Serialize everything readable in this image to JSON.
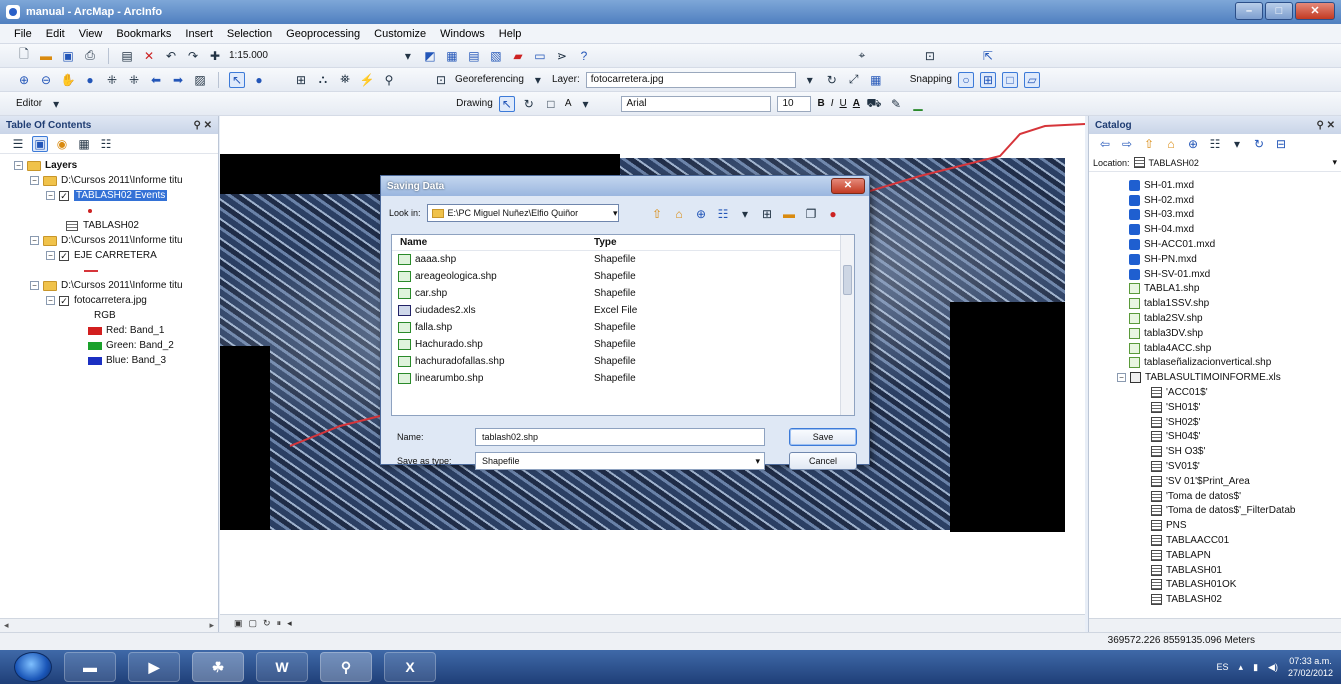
{
  "window": {
    "title": "manual - ArcMap - ArcInfo"
  },
  "menu": [
    "File",
    "Edit",
    "View",
    "Bookmarks",
    "Insert",
    "Selection",
    "Geoprocessing",
    "Customize",
    "Windows",
    "Help"
  ],
  "toolbar1": {
    "scale": "1:15.000"
  },
  "toolbar2": {
    "georef_label": "Georeferencing",
    "layer_label": "Layer:",
    "layer_value": "fotocarretera.jpg",
    "snapping_label": "Snapping"
  },
  "toolbar3": {
    "editor_label": "Editor",
    "drawing_label": "Drawing",
    "font_name": "Arial",
    "font_size": "10",
    "bold": "B",
    "italic": "I",
    "underline": "U",
    "font_color": "A"
  },
  "toc": {
    "title": "Table Of Contents",
    "layers_label": "Layers",
    "groups": [
      {
        "path": "D:\\Cursos 2011\\Informe titu",
        "layer": "TABLASH02 Events"
      },
      {
        "table": "TABLASH02"
      },
      {
        "path": "D:\\Cursos 2011\\Informe titu",
        "layer": "EJE CARRETERA"
      },
      {
        "path": "D:\\Cursos 2011\\Informe titu",
        "layer": "fotocarretera.jpg"
      }
    ],
    "rgb_label": "RGB",
    "bands": [
      {
        "label": "Red:  Band_1",
        "color": "#d21f1f"
      },
      {
        "label": "Green:  Band_2",
        "color": "#1aa12b"
      },
      {
        "label": "Blue:  Band_3",
        "color": "#1b2fc2"
      }
    ]
  },
  "dialog": {
    "title": "Saving Data",
    "look_in_label": "Look in:",
    "look_in_value": "E:\\PC Miguel Nuñez\\Elfio Quiñor",
    "columns": [
      "Name",
      "Type"
    ],
    "files": [
      {
        "name": "aaaa.shp",
        "type": "Shapefile",
        "kind": "shp"
      },
      {
        "name": "areageologica.shp",
        "type": "Shapefile",
        "kind": "shp"
      },
      {
        "name": "car.shp",
        "type": "Shapefile",
        "kind": "shp"
      },
      {
        "name": "ciudades2.xls",
        "type": "Excel File",
        "kind": "xls"
      },
      {
        "name": "falla.shp",
        "type": "Shapefile",
        "kind": "shp"
      },
      {
        "name": "Hachurado.shp",
        "type": "Shapefile",
        "kind": "shp"
      },
      {
        "name": "hachuradofallas.shp",
        "type": "Shapefile",
        "kind": "shp"
      },
      {
        "name": "linearumbo.shp",
        "type": "Shapefile",
        "kind": "shp"
      }
    ],
    "name_label": "Name:",
    "name_value": "tablash02.shp",
    "type_label": "Save as type:",
    "type_value": "Shapefile",
    "save_label": "Save",
    "cancel_label": "Cancel"
  },
  "catalog": {
    "title": "Catalog",
    "location_label": "Location:",
    "location_value": "TABLASH02",
    "items": [
      {
        "label": "SH-01.mxd",
        "kind": "mxd"
      },
      {
        "label": "SH-02.mxd",
        "kind": "mxd"
      },
      {
        "label": "SH-03.mxd",
        "kind": "mxd"
      },
      {
        "label": "SH-04.mxd",
        "kind": "mxd"
      },
      {
        "label": "SH-ACC01.mxd",
        "kind": "mxd"
      },
      {
        "label": "SH-PN.mxd",
        "kind": "mxd"
      },
      {
        "label": "SH-SV-01.mxd",
        "kind": "mxd"
      },
      {
        "label": "TABLA1.shp",
        "kind": "shp"
      },
      {
        "label": "tabla1SSV.shp",
        "kind": "shp"
      },
      {
        "label": "tabla2SV.shp",
        "kind": "shp"
      },
      {
        "label": "tabla3DV.shp",
        "kind": "shp"
      },
      {
        "label": "tabla4ACC.shp",
        "kind": "shp"
      },
      {
        "label": "tablaseñalizacionvertical.shp",
        "kind": "shp"
      },
      {
        "label": "TABLASULTIMOINFORME.xls",
        "kind": "xls"
      },
      {
        "label": "'ACC01$'",
        "kind": "tbl"
      },
      {
        "label": "'SH01$'",
        "kind": "tbl"
      },
      {
        "label": "'SH02$'",
        "kind": "tbl"
      },
      {
        "label": "'SH04$'",
        "kind": "tbl"
      },
      {
        "label": "'SH O3$'",
        "kind": "tbl"
      },
      {
        "label": "'SV01$'",
        "kind": "tbl"
      },
      {
        "label": "'SV 01'$Print_Area",
        "kind": "tbl"
      },
      {
        "label": "'Toma de datos$'",
        "kind": "tbl"
      },
      {
        "label": "'Toma de datos$'_FilterDatab",
        "kind": "tbl"
      },
      {
        "label": "PNS",
        "kind": "tbl"
      },
      {
        "label": "TABLAACC01",
        "kind": "tbl"
      },
      {
        "label": "TABLAPN",
        "kind": "tbl"
      },
      {
        "label": "TABLASH01",
        "kind": "tbl"
      },
      {
        "label": "TABLASH01OK",
        "kind": "tbl"
      },
      {
        "label": "TABLASH02",
        "kind": "tbl"
      }
    ]
  },
  "status": {
    "coords": "369572.226  8559135.096 Meters"
  },
  "taskbar": {
    "apps": [
      "explorer",
      "media-player",
      "arcmap",
      "word",
      "search",
      "excel"
    ],
    "lang": "ES",
    "time": "07:33 a.m.",
    "date": "27/02/2012"
  }
}
